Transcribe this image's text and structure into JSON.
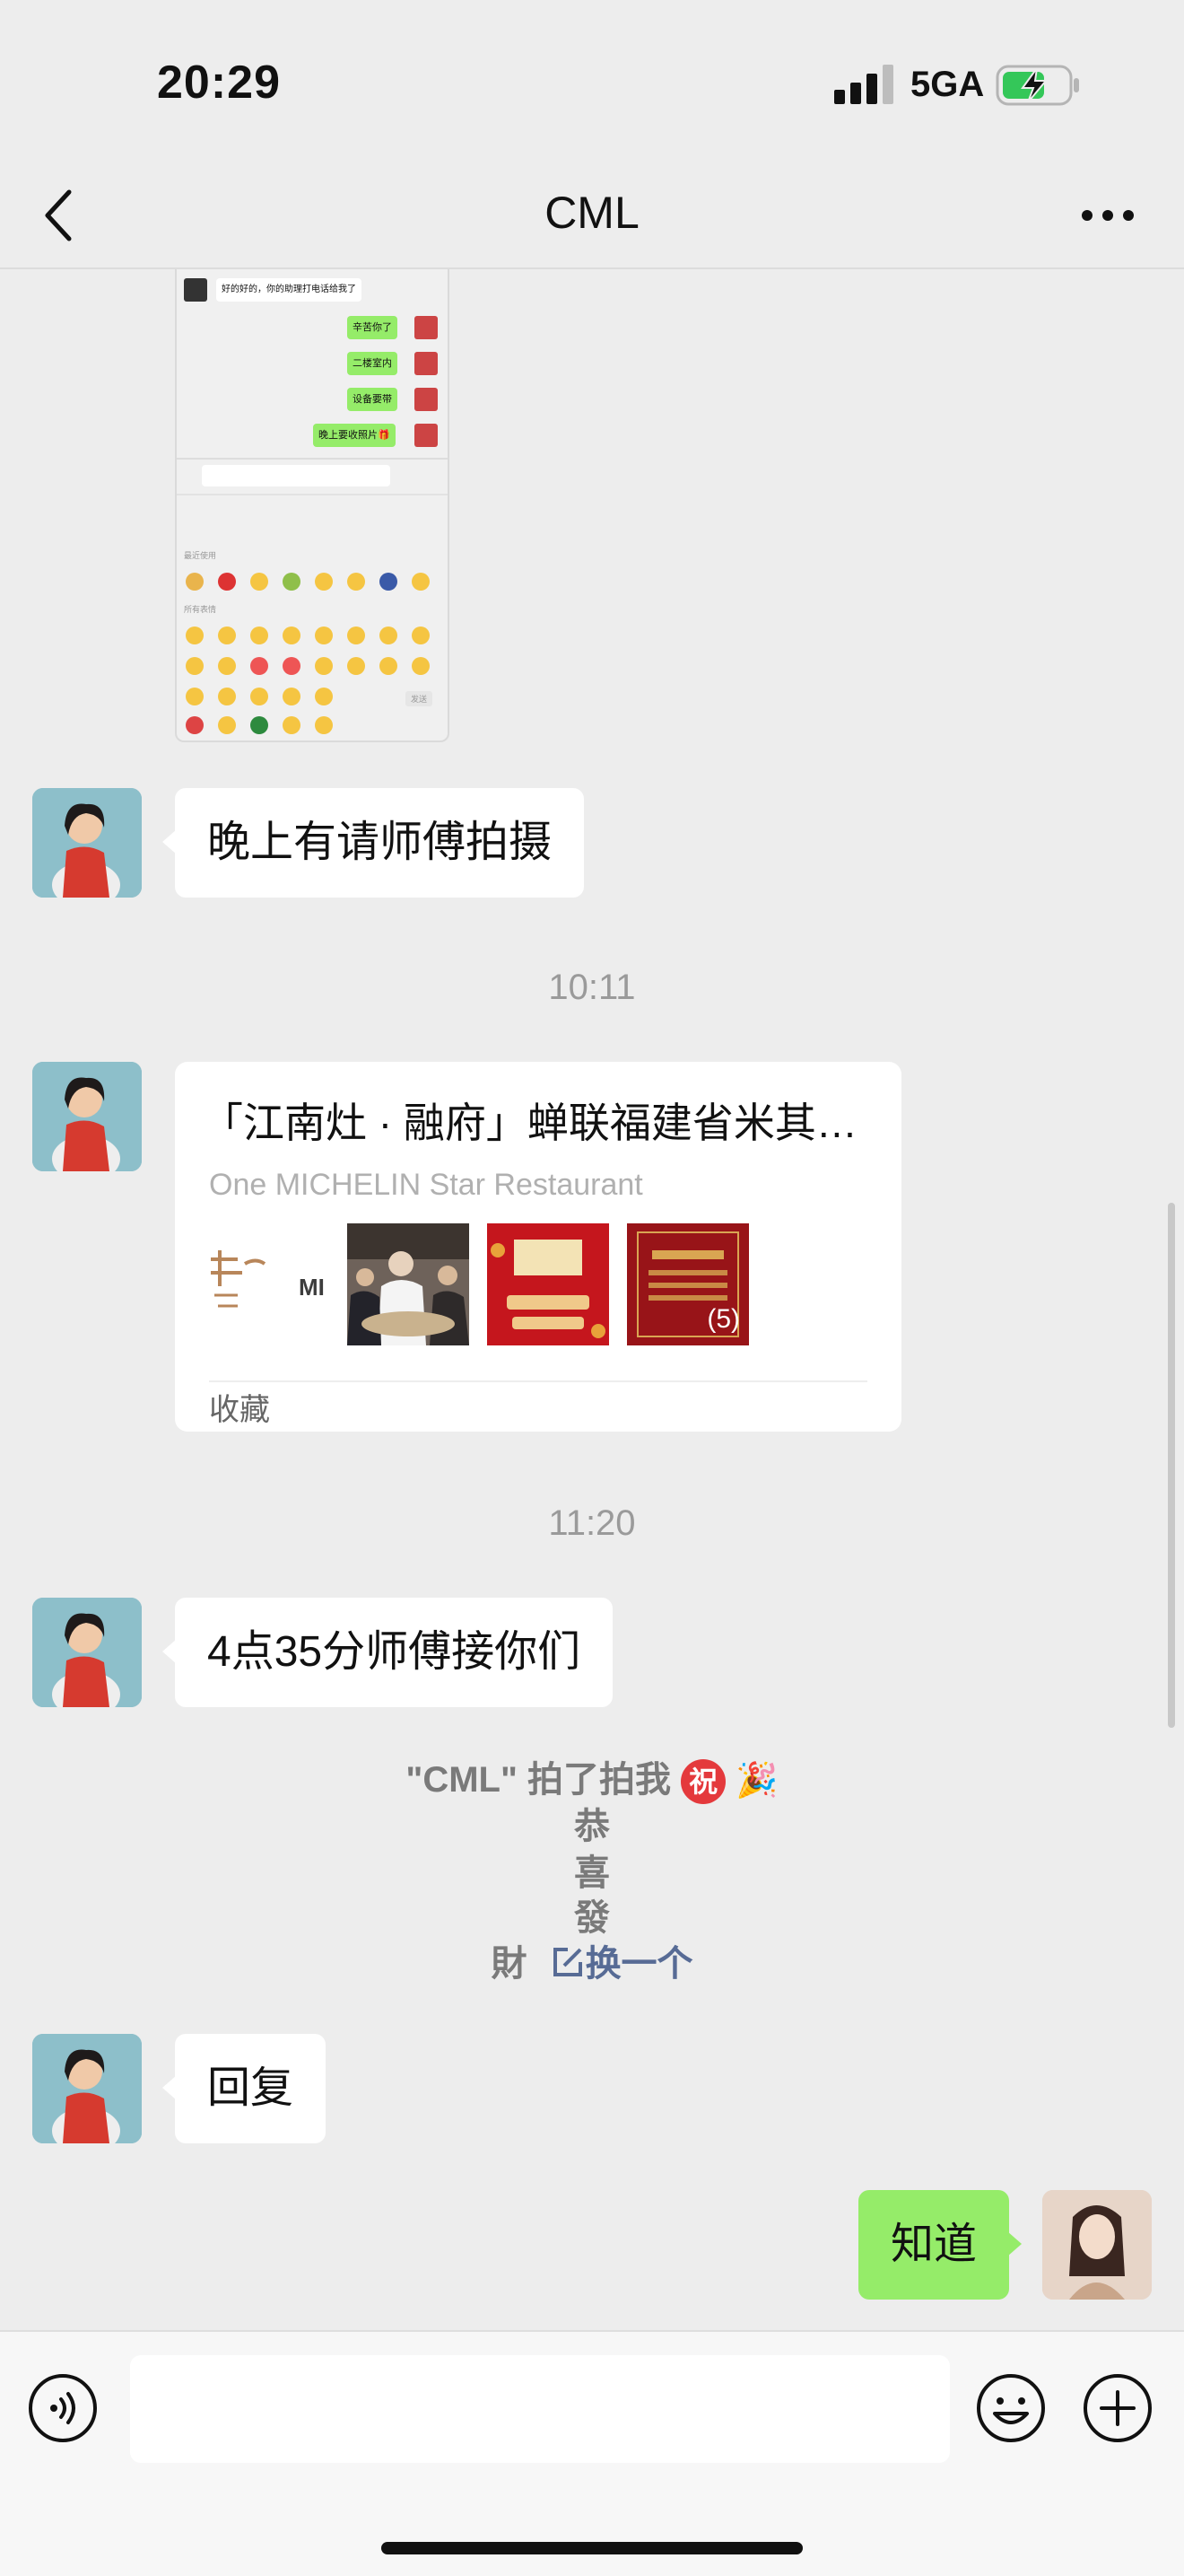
{
  "status": {
    "time": "20:29",
    "network": "5GA"
  },
  "nav": {
    "title": "CML"
  },
  "screenshot_msg": {
    "top_text": "好的好的，你的助理打电话给我了",
    "bubbles": [
      "辛苦你了",
      "二楼室内",
      "设备要带",
      "晚上要收照片🎁"
    ],
    "recent_label": "最近使用",
    "all_label": "所有表情",
    "send_label": "发送"
  },
  "messages": {
    "m1": "晚上有请师傅拍摄",
    "t1": "10:11",
    "card": {
      "title": "「江南灶 · 融府」蝉联福建省米其林一星餐厅",
      "subtitle": "One MICHELIN Star Restaurant",
      "logo_text": "MI",
      "more_count": "(5)",
      "footer": "收藏"
    },
    "t2": "11:20",
    "m2": "4点35分师傅接你们",
    "pat": {
      "line1": "\"CML\" 拍了拍我",
      "badge": "祝",
      "emoji": "🎉",
      "line2": "恭",
      "line3": "喜",
      "line4": "發",
      "line5": "財",
      "change_label": "换一个"
    },
    "m3": "回复",
    "m4": "知道"
  },
  "colors": {
    "mine_bubble": "#95ec69",
    "link": "#576b95",
    "badge": "#e4393c"
  }
}
